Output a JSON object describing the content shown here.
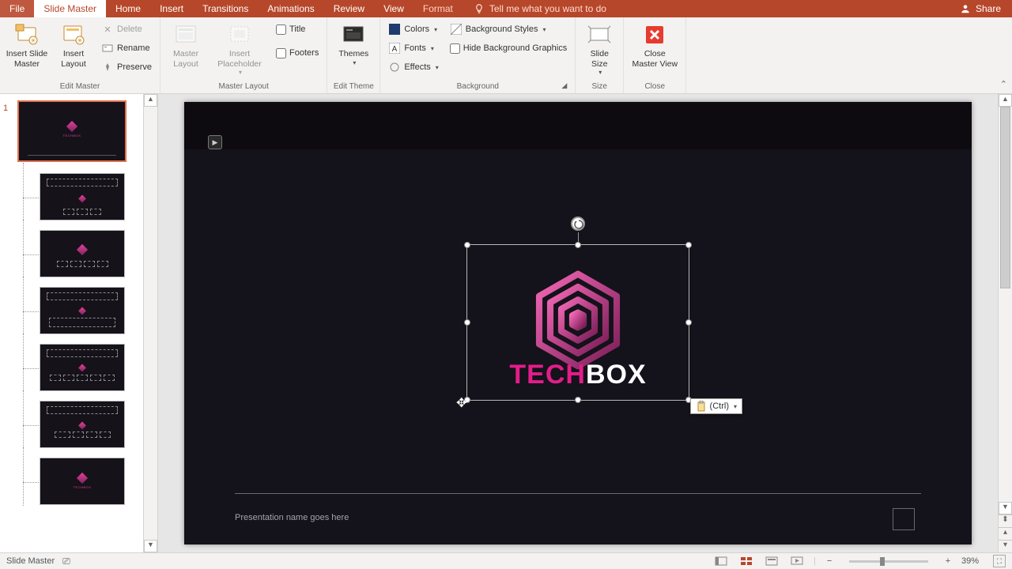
{
  "tabs": {
    "file": "File",
    "slideMaster": "Slide Master",
    "home": "Home",
    "insert": "Insert",
    "transitions": "Transitions",
    "animations": "Animations",
    "review": "Review",
    "view": "View",
    "format": "Format"
  },
  "titlebar": {
    "tellMe": "Tell me what you want to do",
    "share": "Share"
  },
  "ribbon": {
    "editMaster": {
      "insertSlideMaster": "Insert Slide\nMaster",
      "insertLayout": "Insert\nLayout",
      "delete": "Delete",
      "rename": "Rename",
      "preserve": "Preserve",
      "group": "Edit Master"
    },
    "masterLayout": {
      "masterLayout": "Master\nLayout",
      "insertPlaceholder": "Insert\nPlaceholder",
      "title": "Title",
      "footers": "Footers",
      "group": "Master Layout"
    },
    "editTheme": {
      "themes": "Themes",
      "group": "Edit Theme"
    },
    "background": {
      "colors": "Colors",
      "fonts": "Fonts",
      "effects": "Effects",
      "backgroundStyles": "Background Styles",
      "hideBackground": "Hide Background Graphics",
      "group": "Background"
    },
    "size": {
      "slideSize": "Slide\nSize",
      "group": "Size"
    },
    "close": {
      "closeMasterView": "Close\nMaster View",
      "group": "Close"
    }
  },
  "canvas": {
    "logoA": "TECH",
    "logoB": "BOX",
    "footerText": "Presentation name goes here",
    "pasteCtrl": "(Ctrl)"
  },
  "thumbs": {
    "masterIndex": "1"
  },
  "status": {
    "mode": "Slide Master",
    "zoom": "39%"
  }
}
